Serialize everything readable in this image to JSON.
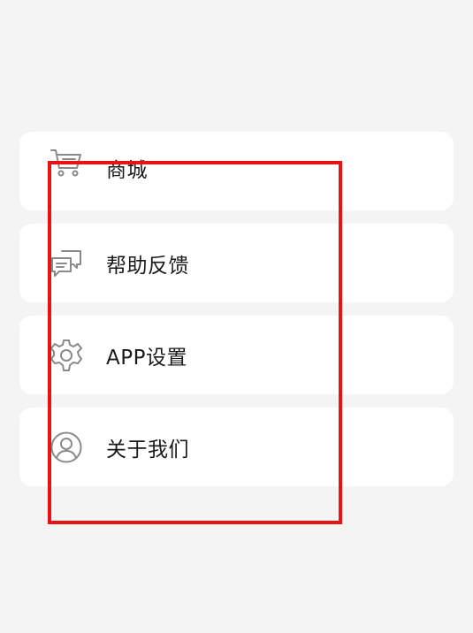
{
  "menu": {
    "items": [
      {
        "id": "shop",
        "label": "商城",
        "icon": "shopping-cart-icon"
      },
      {
        "id": "feedback",
        "label": "帮助反馈",
        "icon": "chat-bubbles-icon"
      },
      {
        "id": "settings",
        "label": "APP设置",
        "icon": "gear-icon"
      },
      {
        "id": "about",
        "label": "关于我们",
        "icon": "user-circle-icon"
      }
    ]
  },
  "colors": {
    "background": "#f4f4f4",
    "card": "#ffffff",
    "text": "#1a1a1a",
    "icon": "#8a8a8a",
    "highlight": "#e81414"
  }
}
